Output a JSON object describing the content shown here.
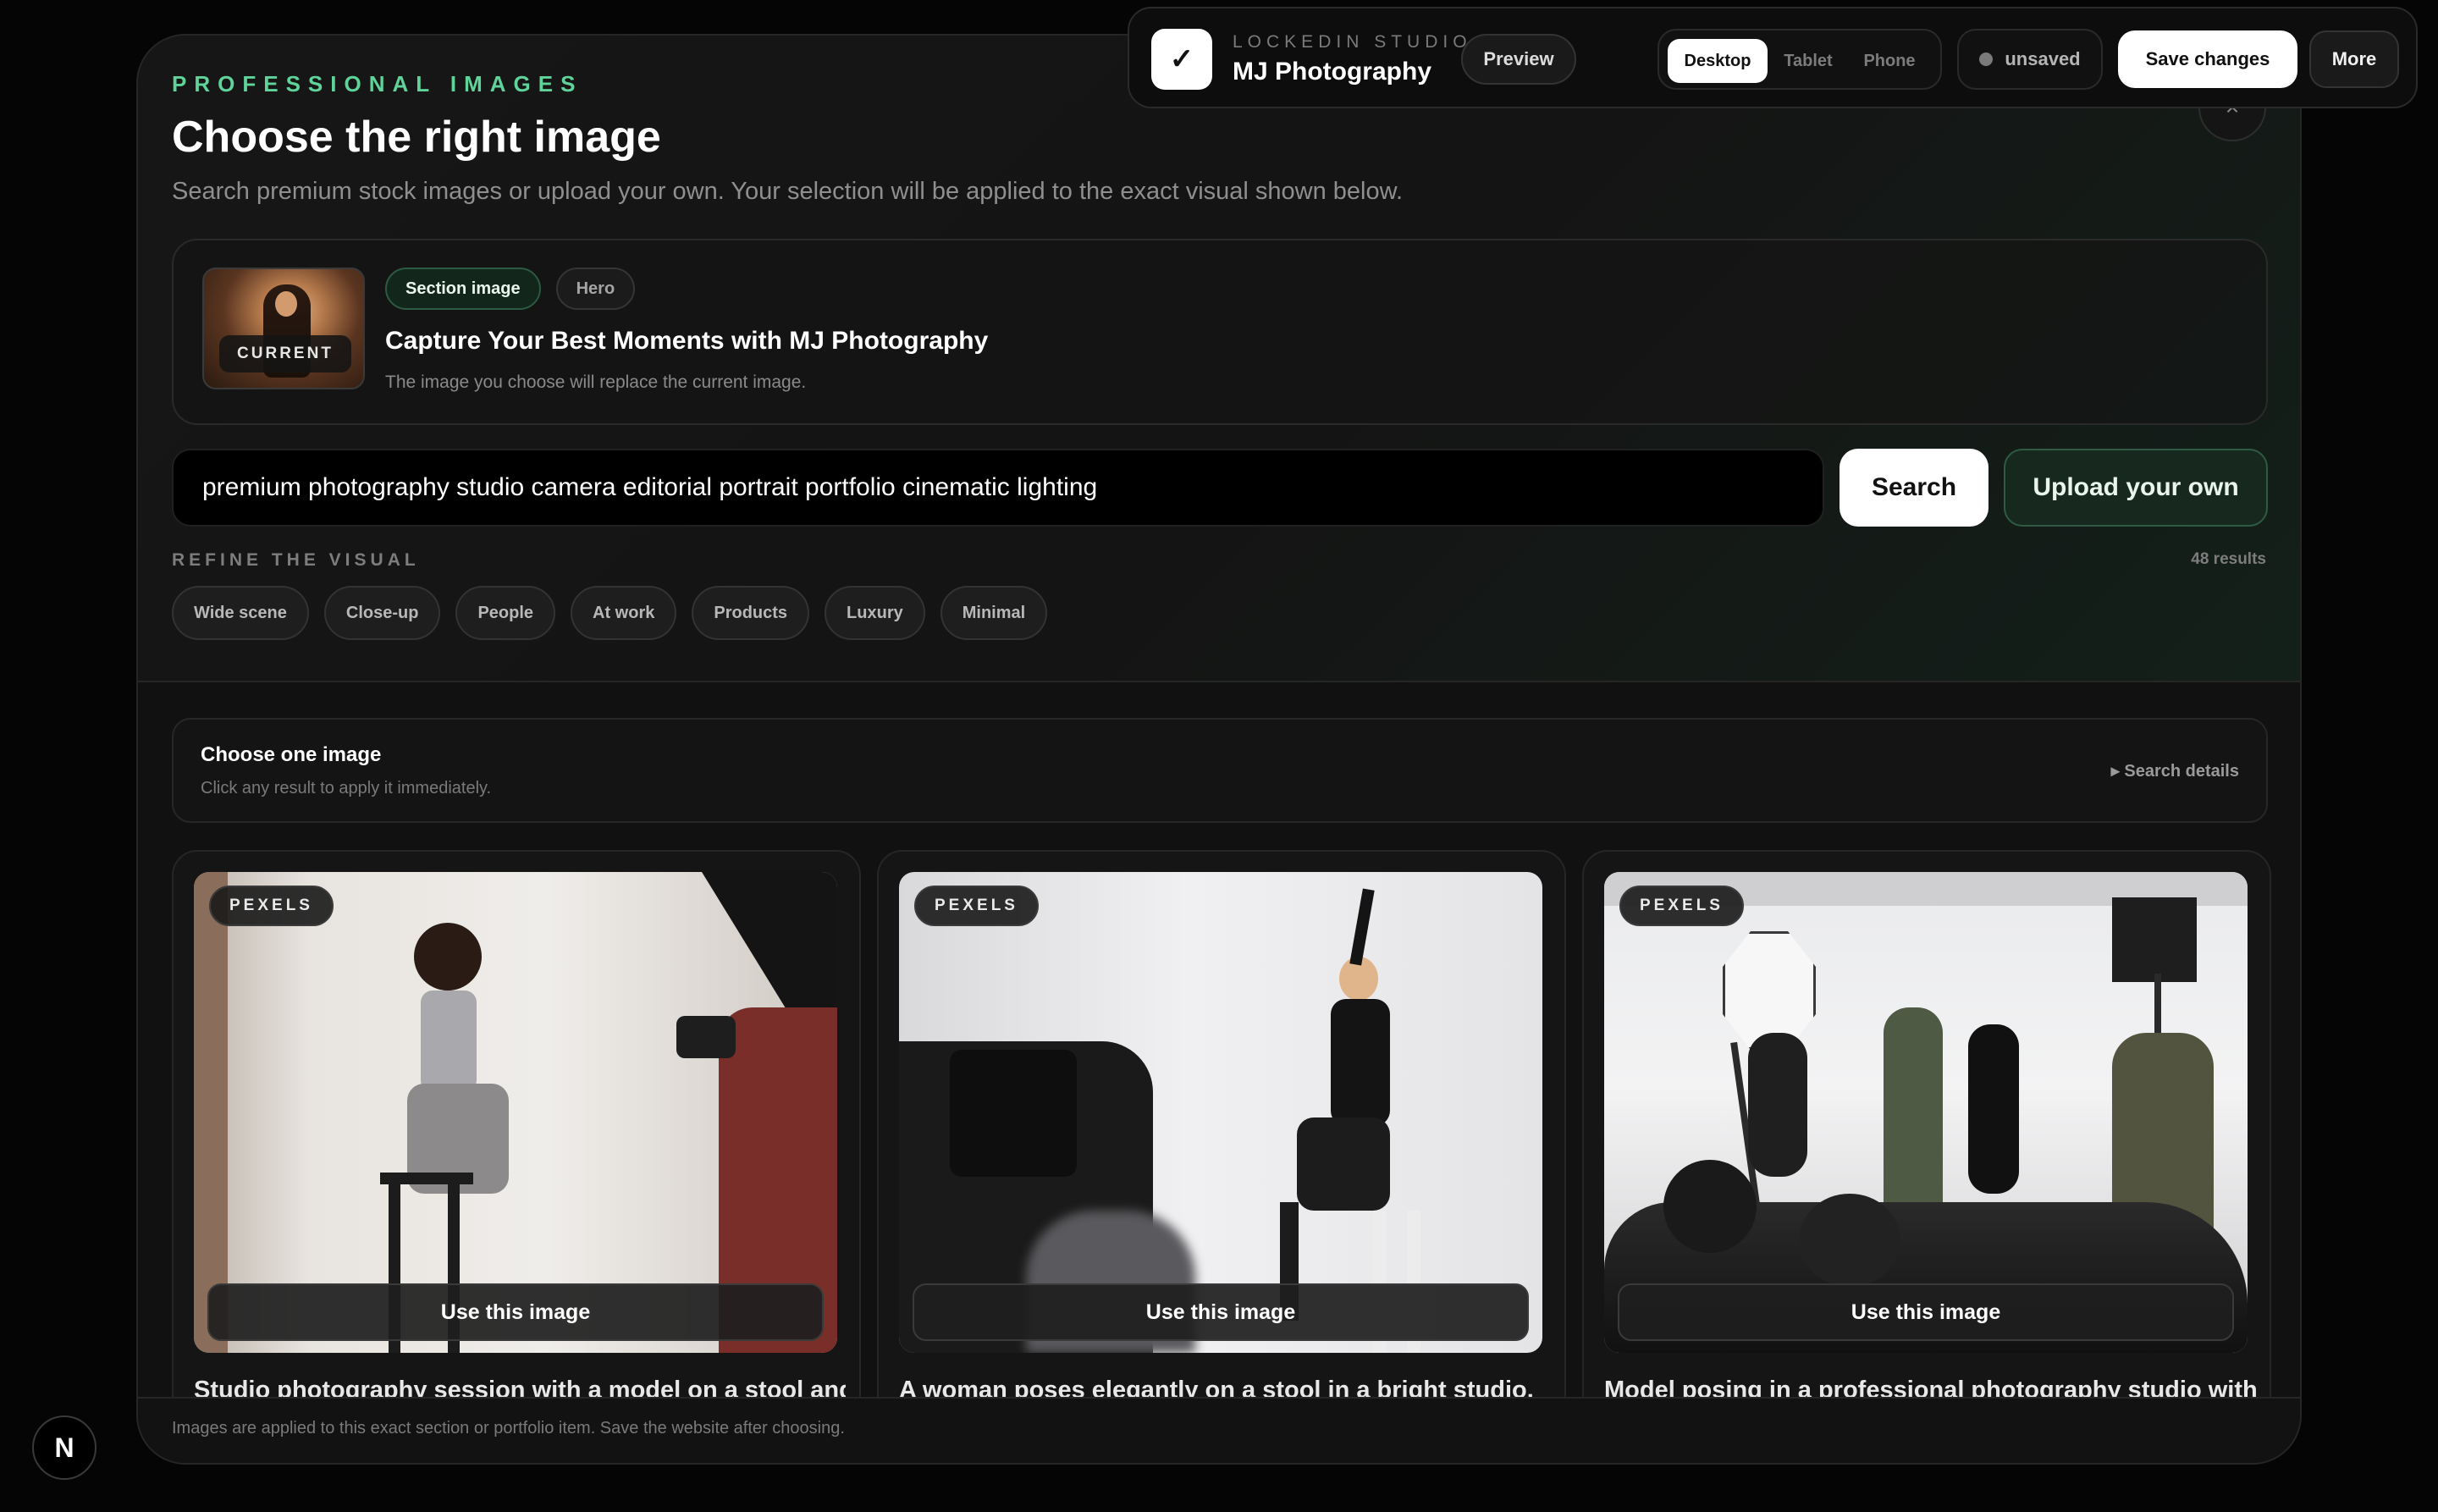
{
  "toolbar": {
    "logo_glyph": "✓",
    "brand_eyebrow": "LOCKEDIN STUDIO",
    "brand_name": "MJ Photography",
    "preview": "Preview",
    "devices": [
      "Desktop",
      "Tablet",
      "Phone"
    ],
    "active_device": "Desktop",
    "status": "unsaved",
    "save": "Save changes",
    "more": "More"
  },
  "header": {
    "eyebrow": "PROFESSIONAL IMAGES",
    "title": "Choose the right image",
    "subtitle": "Search premium stock images or upload your own. Your selection will be applied to the exact visual shown below."
  },
  "current": {
    "badge": "CURRENT",
    "tags": [
      "Section image",
      "Hero"
    ],
    "heading": "Capture Your Best Moments with MJ Photography",
    "subtext": "The image you choose will replace the current image."
  },
  "search": {
    "query": "premium photography studio camera editorial portrait portfolio cinematic lighting",
    "button": "Search",
    "upload": "Upload your own"
  },
  "refine": {
    "label": "REFINE THE VISUAL",
    "results": "48 results",
    "filters": [
      "Wide scene",
      "Close-up",
      "People",
      "At work",
      "Products",
      "Luxury",
      "Minimal"
    ]
  },
  "choose": {
    "title": "Choose one image",
    "subtitle": "Click any result to apply it immediately.",
    "details": "▸ Search details"
  },
  "results": [
    {
      "source": "PEXELS",
      "action": "Use this image",
      "caption": "Studio photography session with a model on a stool and"
    },
    {
      "source": "PEXELS",
      "action": "Use this image",
      "caption": "A woman poses elegantly on a stool in a bright studio."
    },
    {
      "source": "PEXELS",
      "action": "Use this image",
      "caption": "Model posing in a professional photography studio with"
    }
  ],
  "footer": {
    "text": "Images are applied to this exact section or portfolio item. Save the website after choosing."
  },
  "badge": {
    "glyph": "N"
  },
  "colors": {
    "accent_green": "#5fd39a",
    "background": "#050505",
    "panel": "#111111"
  }
}
